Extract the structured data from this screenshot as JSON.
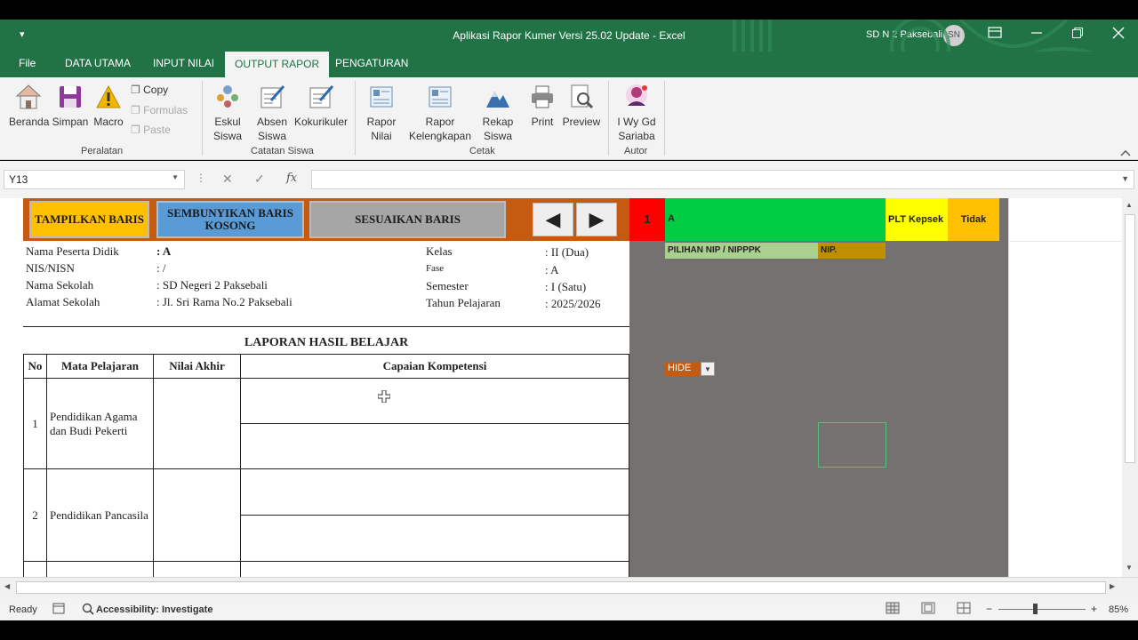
{
  "window": {
    "title": "Aplikasi Rapor Kumer Versi 25.02 Update  -  Excel",
    "org": "SD N 2 Paksebali",
    "avatar": "SN",
    "qat": "▾"
  },
  "tabs": [
    "File",
    "DATA UTAMA",
    "INPUT NILAI",
    "OUTPUT RAPOR",
    "PENGATURAN"
  ],
  "ribbon": {
    "peralatan": {
      "group": "Peralatan",
      "beranda": "Beranda",
      "simpan": "Simpan",
      "macro": "Macro",
      "copy": "Copy",
      "formulas": "Formulas",
      "paste": "Paste"
    },
    "catatan": {
      "group": "Catatan Siswa",
      "eskul_1": "Eskul",
      "eskul_2": "Siswa",
      "absen_1": "Absen",
      "absen_2": "Siswa",
      "kokurikuler": "Kokurikuler"
    },
    "cetak": {
      "group": "Cetak",
      "rapor_nilai_1": "Rapor",
      "rapor_nilai_2": "Nilai",
      "rapor_lengkap_1": "Rapor",
      "rapor_lengkap_2": "Kelengkapan",
      "rekap_1": "Rekap",
      "rekap_2": "Siswa",
      "print": "Print",
      "preview": "Preview"
    },
    "autor": {
      "group": "Autor",
      "name_1": "I Wy Gd",
      "name_2": "Sariaba"
    }
  },
  "formula_bar": {
    "name_box": "Y13",
    "fx": "fx",
    "cancel": "✕",
    "enter": "✓"
  },
  "sheet": {
    "btn_tampilkan": "TAMPILKAN BARIS",
    "btn_sembunyikan": "SEMBUNYIKAN BARIS KOSONG",
    "btn_sesuaikan": "SESUAIKAN BARIS",
    "nav_prev": "◀",
    "nav_next": "▶",
    "info": {
      "nama_label": "Nama Peserta Didik",
      "nama_value": ": A",
      "nis_label": "NIS/NISN",
      "nis_value": ":  /",
      "sekolah_label": "Nama Sekolah",
      "sekolah_value": ": SD Negeri 2 Paksebali",
      "alamat_label": "Alamat Sekolah",
      "alamat_value": ": Jl. Sri Rama No.2 Paksebali",
      "kelas_label": "Kelas",
      "kelas_value": ": II (Dua)",
      "fase_label": "Fase",
      "fase_value": ": A",
      "semester_label": "Semester",
      "semester_value": ": I (Satu)",
      "tahun_label": "Tahun Pelajaran",
      "tahun_value": ": 2025/2026"
    },
    "report_title": "LAPORAN HASIL BELAJAR",
    "headers": [
      "No",
      "Mata Pelajaran",
      "Nilai Akhir",
      "Capaian Kompetensi"
    ],
    "rows": [
      {
        "no": "1",
        "subject": "Pendidikan Agama dan Budi Pekerti"
      },
      {
        "no": "2",
        "subject": "Pendidikan Pancasila"
      }
    ],
    "side": {
      "index": "1",
      "name": "A",
      "plt": "PLT Kepsek",
      "tidak": "Tidak",
      "pilihan": "PILIHAN NIP / NIPPPK",
      "nip": "NIP.",
      "hide": "HIDE"
    }
  },
  "status": {
    "ready": "Ready",
    "accessibility": "Accessibility: Investigate",
    "zoom": "85%"
  },
  "colors": {
    "excel_green": "#217346",
    "banner_orange": "#c55a11",
    "side_grey": "#767171"
  }
}
